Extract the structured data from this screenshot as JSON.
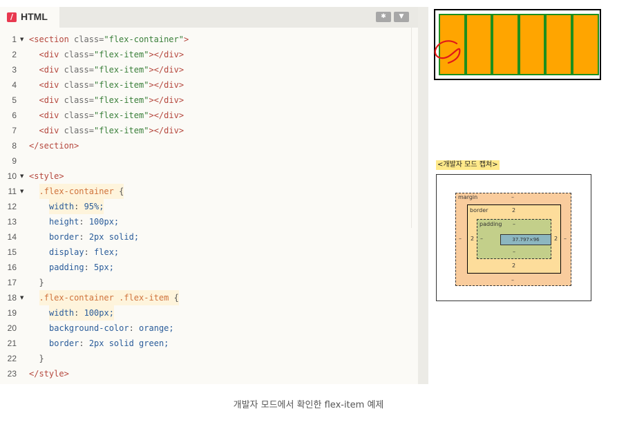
{
  "editor": {
    "language_badge": "/",
    "language_label": "HTML",
    "settings_icon": "gear-icon",
    "collapse_icon": "chevron-down-icon",
    "lines": [
      {
        "num": "1",
        "fold": true,
        "indent": 0,
        "hl": false,
        "tokens": [
          {
            "t": "<section",
            "c": "tag"
          },
          {
            "t": " class=",
            "c": "attr"
          },
          {
            "t": "\"flex-container\"",
            "c": "str"
          },
          {
            "t": ">",
            "c": "tag"
          }
        ]
      },
      {
        "num": "2",
        "fold": false,
        "indent": 1,
        "hl": false,
        "tokens": [
          {
            "t": "<div",
            "c": "tag"
          },
          {
            "t": " class=",
            "c": "attr"
          },
          {
            "t": "\"flex-item\"",
            "c": "str"
          },
          {
            "t": "></div>",
            "c": "tag"
          }
        ]
      },
      {
        "num": "3",
        "fold": false,
        "indent": 1,
        "hl": false,
        "tokens": [
          {
            "t": "<div",
            "c": "tag"
          },
          {
            "t": " class=",
            "c": "attr"
          },
          {
            "t": "\"flex-item\"",
            "c": "str"
          },
          {
            "t": "></div>",
            "c": "tag"
          }
        ]
      },
      {
        "num": "4",
        "fold": false,
        "indent": 1,
        "hl": false,
        "tokens": [
          {
            "t": "<div",
            "c": "tag"
          },
          {
            "t": " class=",
            "c": "attr"
          },
          {
            "t": "\"flex-item\"",
            "c": "str"
          },
          {
            "t": "></div>",
            "c": "tag"
          }
        ]
      },
      {
        "num": "5",
        "fold": false,
        "indent": 1,
        "hl": false,
        "tokens": [
          {
            "t": "<div",
            "c": "tag"
          },
          {
            "t": " class=",
            "c": "attr"
          },
          {
            "t": "\"flex-item\"",
            "c": "str"
          },
          {
            "t": "></div>",
            "c": "tag"
          }
        ]
      },
      {
        "num": "6",
        "fold": false,
        "indent": 1,
        "hl": false,
        "tokens": [
          {
            "t": "<div",
            "c": "tag"
          },
          {
            "t": " class=",
            "c": "attr"
          },
          {
            "t": "\"flex-item\"",
            "c": "str"
          },
          {
            "t": "></div>",
            "c": "tag"
          }
        ]
      },
      {
        "num": "7",
        "fold": false,
        "indent": 1,
        "hl": false,
        "tokens": [
          {
            "t": "<div",
            "c": "tag"
          },
          {
            "t": " class=",
            "c": "attr"
          },
          {
            "t": "\"flex-item\"",
            "c": "str"
          },
          {
            "t": "></div>",
            "c": "tag"
          }
        ]
      },
      {
        "num": "8",
        "fold": false,
        "indent": 0,
        "hl": false,
        "tokens": [
          {
            "t": "</section>",
            "c": "tag"
          }
        ]
      },
      {
        "num": "9",
        "fold": false,
        "indent": 0,
        "hl": false,
        "tokens": []
      },
      {
        "num": "10",
        "fold": true,
        "indent": 0,
        "hl": false,
        "tokens": [
          {
            "t": "<style>",
            "c": "tag"
          }
        ]
      },
      {
        "num": "11",
        "fold": true,
        "indent": 1,
        "hl": true,
        "tokens": [
          {
            "t": ".flex-container",
            "c": "sel"
          },
          {
            "t": " {",
            "c": "plain"
          }
        ]
      },
      {
        "num": "12",
        "fold": false,
        "indent": 2,
        "hl": true,
        "tokens": [
          {
            "t": "width",
            "c": "prop"
          },
          {
            "t": ": ",
            "c": "plain"
          },
          {
            "t": "95%;",
            "c": "val"
          }
        ]
      },
      {
        "num": "13",
        "fold": false,
        "indent": 2,
        "hl": false,
        "tokens": [
          {
            "t": "height",
            "c": "prop"
          },
          {
            "t": ": ",
            "c": "plain"
          },
          {
            "t": "100px;",
            "c": "val"
          }
        ]
      },
      {
        "num": "14",
        "fold": false,
        "indent": 2,
        "hl": false,
        "tokens": [
          {
            "t": "border",
            "c": "prop"
          },
          {
            "t": ": ",
            "c": "plain"
          },
          {
            "t": "2px solid;",
            "c": "val"
          }
        ]
      },
      {
        "num": "15",
        "fold": false,
        "indent": 2,
        "hl": false,
        "tokens": [
          {
            "t": "display",
            "c": "prop"
          },
          {
            "t": ": ",
            "c": "plain"
          },
          {
            "t": "flex;",
            "c": "val"
          }
        ]
      },
      {
        "num": "16",
        "fold": false,
        "indent": 2,
        "hl": false,
        "tokens": [
          {
            "t": "padding",
            "c": "prop"
          },
          {
            "t": ": ",
            "c": "plain"
          },
          {
            "t": "5px;",
            "c": "val"
          }
        ]
      },
      {
        "num": "17",
        "fold": false,
        "indent": 1,
        "hl": false,
        "tokens": [
          {
            "t": "}",
            "c": "plain"
          }
        ]
      },
      {
        "num": "18",
        "fold": true,
        "indent": 1,
        "hl": true,
        "tokens": [
          {
            "t": ".flex-container .flex-item",
            "c": "sel"
          },
          {
            "t": " {",
            "c": "plain"
          }
        ]
      },
      {
        "num": "19",
        "fold": false,
        "indent": 2,
        "hl": true,
        "tokens": [
          {
            "t": "width",
            "c": "prop"
          },
          {
            "t": ": ",
            "c": "plain"
          },
          {
            "t": "100px;",
            "c": "val"
          }
        ]
      },
      {
        "num": "20",
        "fold": false,
        "indent": 2,
        "hl": false,
        "tokens": [
          {
            "t": "background-color",
            "c": "prop"
          },
          {
            "t": ": ",
            "c": "plain"
          },
          {
            "t": "orange;",
            "c": "val"
          }
        ]
      },
      {
        "num": "21",
        "fold": false,
        "indent": 2,
        "hl": false,
        "tokens": [
          {
            "t": "border",
            "c": "prop"
          },
          {
            "t": ": ",
            "c": "plain"
          },
          {
            "t": "2px solid green;",
            "c": "val"
          }
        ]
      },
      {
        "num": "22",
        "fold": false,
        "indent": 1,
        "hl": false,
        "tokens": [
          {
            "t": "}",
            "c": "plain"
          }
        ]
      },
      {
        "num": "23",
        "fold": false,
        "indent": 0,
        "hl": false,
        "tokens": [
          {
            "t": "</style>",
            "c": "tag"
          }
        ]
      }
    ]
  },
  "preview": {
    "flex_item_count": 6,
    "item_color": "#ffa500",
    "item_border_color": "#1d8f1d"
  },
  "devtools": {
    "caption": "<개발자 모드 캡쳐>",
    "margin_label": "margin",
    "margin_top": "–",
    "margin_bottom": "–",
    "margin_left": "–",
    "margin_right": "–",
    "border_label": "border",
    "border_top": "2",
    "border_bottom": "2",
    "border_left": "2",
    "border_right": "2",
    "padding_label": "padding",
    "padding_top": "–",
    "padding_bottom": "–",
    "padding_left": "–",
    "padding_right": "–",
    "content_size": "37.797×96"
  },
  "figure_caption": "개발자 모드에서 확인한 flex-item 예제"
}
